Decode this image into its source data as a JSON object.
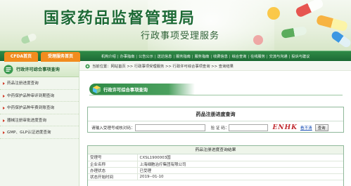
{
  "banner": {
    "title": "国家药品监督管理局",
    "subtitle": "行政事项受理服务"
  },
  "nav": {
    "tabs": [
      "CFDA首页",
      "受理服务首页"
    ],
    "links": [
      "机构介绍",
      "办事指南",
      "公告公示",
      "送达信息",
      "服务指南",
      "服务指南",
      "收费信息",
      "综合查询",
      "在线服务",
      "交流与沟通",
      "投诉与建议"
    ]
  },
  "sidebar": {
    "title": "行政许可综合事项查询",
    "items": [
      "药品注册进度查询",
      "中药保护品种审评到期查询",
      "中药保护品种年费到账查询",
      "器械注册审批进度查询",
      "GMP、GLP认证进度查询"
    ]
  },
  "breadcrumb": "当前位置：网站首页 >> 行政事项受理服务 >> 行政许可综合事项查询 >> 查询结果",
  "section_tab": "行政许可综合事项查询",
  "query": {
    "title": "药品注册进度查询",
    "field_label": "请输入受理号或核对码：",
    "captcha_label": "验 证 码：",
    "captcha_text": "ENHK",
    "captcha_link": "看不清",
    "button": "查询"
  },
  "result": {
    "title": "药品注册进度查询结果",
    "rows": [
      {
        "key": "受理号",
        "value": "CXSL1900003国"
      },
      {
        "key": "企业名称",
        "value": "上海细胞治疗集团有限公司"
      },
      {
        "key": "办理状态",
        "value": "已受理"
      },
      {
        "key": "状态开始时间",
        "value": "2019--01-10"
      }
    ]
  },
  "colors": {
    "brand_green": "#1d6a35",
    "tab_orange": "#f28c1e",
    "captcha_red": "#c0282d"
  }
}
